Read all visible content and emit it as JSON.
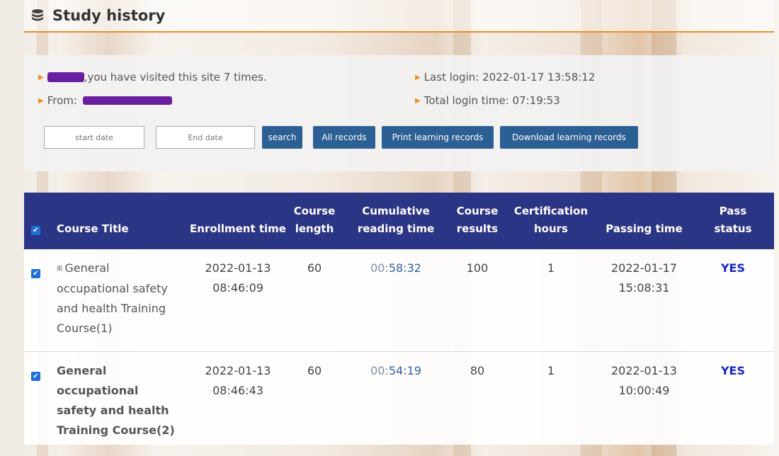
{
  "header": {
    "title": "Study history",
    "icon": "database-icon"
  },
  "info": {
    "visits_text": ",you have visited this site 7 times.",
    "from_label": "From:",
    "last_login": "Last login: 2022-01-17 13:58:12",
    "total_login": "Total login time: 07:19:53"
  },
  "filters": {
    "start_placeholder": "start date",
    "end_placeholder": "End date",
    "search_label": "search",
    "all_records_label": "All records",
    "print_label": "Print learning records",
    "download_label": "Download learning records"
  },
  "table": {
    "headers": {
      "course_title": "Course Title",
      "enrollment_time": "Enrollment time",
      "course_length_1": "Course",
      "course_length_2": "length",
      "cumulative_1": "Cumulative",
      "cumulative_2": "reading time",
      "results_1": "Course",
      "results_2": "results",
      "cert_1": "Certification",
      "cert_2": "hours",
      "passing_time": "Passing time",
      "pass_1": "Pass",
      "pass_2": "status"
    },
    "rows": [
      {
        "title": "General occupational safety and health Training Course(1)",
        "enroll_date": "2022-01-13",
        "enroll_time": "08:46:09",
        "length": "60",
        "cum_prefix": "00:",
        "cum_rest": "58:32",
        "results": "100",
        "cert_hours": "1",
        "pass_date": "2022-01-17",
        "pass_time": "15:08:31",
        "status": "YES"
      },
      {
        "title": "General occupational safety and health Training Course(2)",
        "enroll_date": "2022-01-13",
        "enroll_time": "08:46:43",
        "length": "60",
        "cum_prefix": "00:",
        "cum_rest": "54:19",
        "results": "80",
        "cert_hours": "1",
        "pass_date": "2022-01-13",
        "pass_time": "10:00:49",
        "status": "YES"
      }
    ]
  },
  "colors": {
    "accent": "#f08c1e",
    "table_header": "#2b3586",
    "button": "#2c5f93",
    "yes": "#1427c9"
  }
}
